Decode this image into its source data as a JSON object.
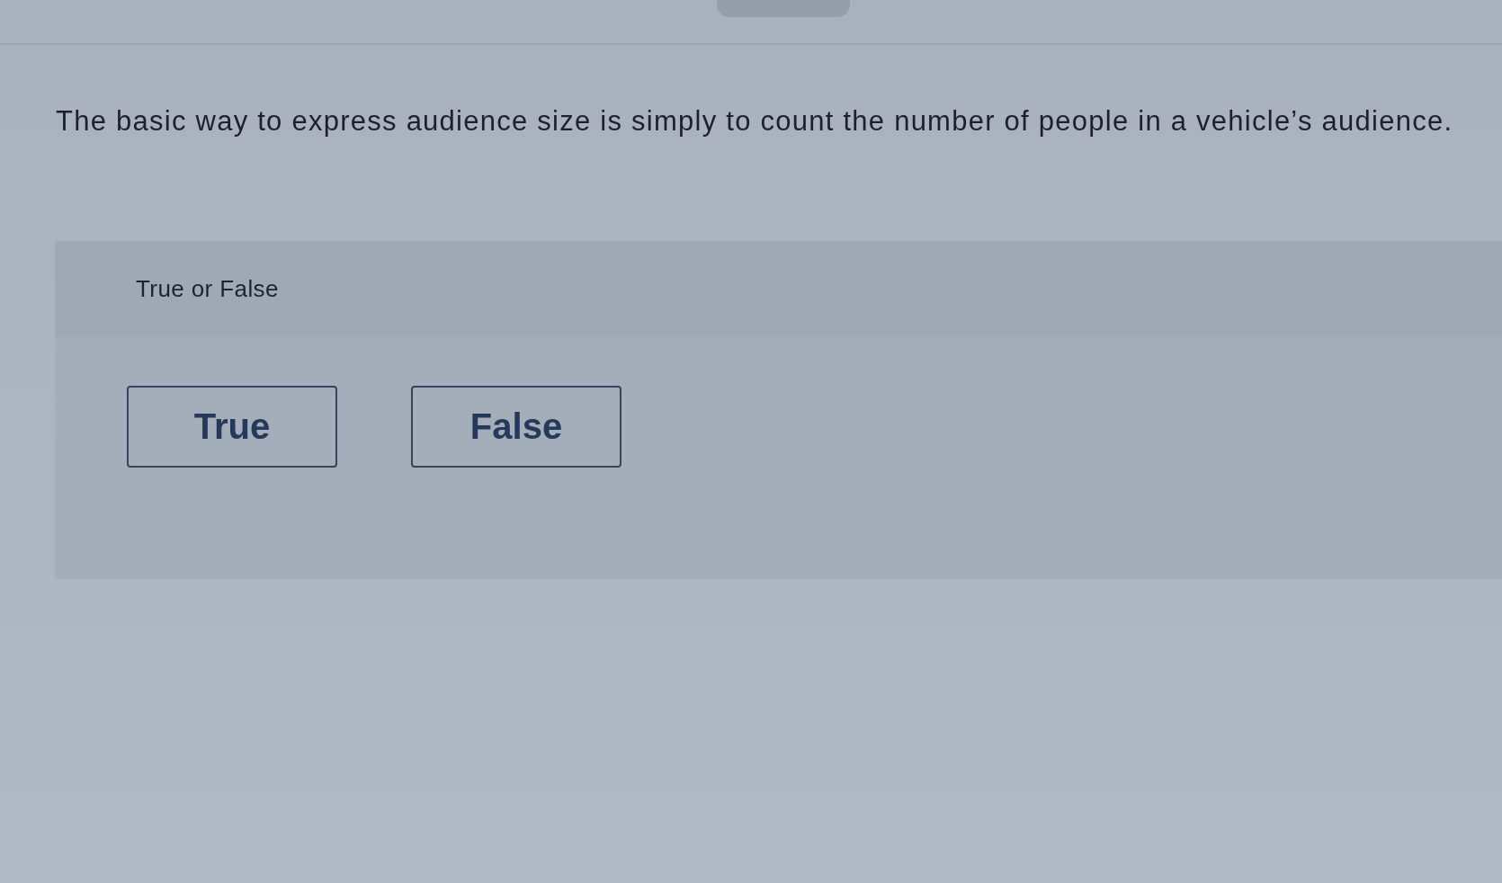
{
  "question": {
    "text": "The basic way to express audience size is simply to count the number of people in a vehicle’s audience."
  },
  "answer_panel": {
    "prompt": "True or False",
    "options": [
      {
        "label": "True",
        "selected": false
      },
      {
        "label": "False",
        "selected": false
      }
    ]
  }
}
